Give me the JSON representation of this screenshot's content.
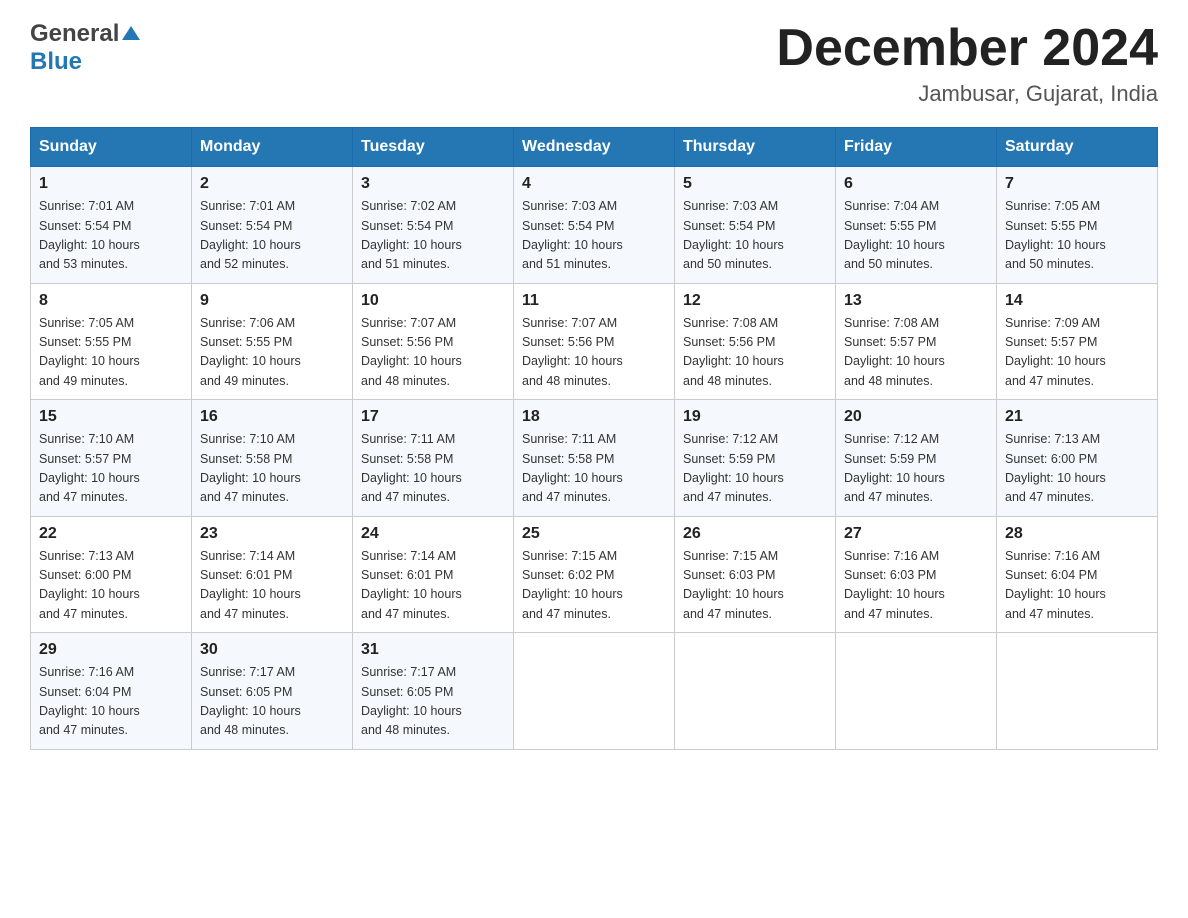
{
  "header": {
    "logo_general": "General",
    "logo_blue": "Blue",
    "month_title": "December 2024",
    "location": "Jambusar, Gujarat, India"
  },
  "days_of_week": [
    "Sunday",
    "Monday",
    "Tuesday",
    "Wednesday",
    "Thursday",
    "Friday",
    "Saturday"
  ],
  "weeks": [
    [
      {
        "day": "1",
        "sunrise": "7:01 AM",
        "sunset": "5:54 PM",
        "daylight": "10 hours and 53 minutes."
      },
      {
        "day": "2",
        "sunrise": "7:01 AM",
        "sunset": "5:54 PM",
        "daylight": "10 hours and 52 minutes."
      },
      {
        "day": "3",
        "sunrise": "7:02 AM",
        "sunset": "5:54 PM",
        "daylight": "10 hours and 51 minutes."
      },
      {
        "day": "4",
        "sunrise": "7:03 AM",
        "sunset": "5:54 PM",
        "daylight": "10 hours and 51 minutes."
      },
      {
        "day": "5",
        "sunrise": "7:03 AM",
        "sunset": "5:54 PM",
        "daylight": "10 hours and 50 minutes."
      },
      {
        "day": "6",
        "sunrise": "7:04 AM",
        "sunset": "5:55 PM",
        "daylight": "10 hours and 50 minutes."
      },
      {
        "day": "7",
        "sunrise": "7:05 AM",
        "sunset": "5:55 PM",
        "daylight": "10 hours and 50 minutes."
      }
    ],
    [
      {
        "day": "8",
        "sunrise": "7:05 AM",
        "sunset": "5:55 PM",
        "daylight": "10 hours and 49 minutes."
      },
      {
        "day": "9",
        "sunrise": "7:06 AM",
        "sunset": "5:55 PM",
        "daylight": "10 hours and 49 minutes."
      },
      {
        "day": "10",
        "sunrise": "7:07 AM",
        "sunset": "5:56 PM",
        "daylight": "10 hours and 48 minutes."
      },
      {
        "day": "11",
        "sunrise": "7:07 AM",
        "sunset": "5:56 PM",
        "daylight": "10 hours and 48 minutes."
      },
      {
        "day": "12",
        "sunrise": "7:08 AM",
        "sunset": "5:56 PM",
        "daylight": "10 hours and 48 minutes."
      },
      {
        "day": "13",
        "sunrise": "7:08 AM",
        "sunset": "5:57 PM",
        "daylight": "10 hours and 48 minutes."
      },
      {
        "day": "14",
        "sunrise": "7:09 AM",
        "sunset": "5:57 PM",
        "daylight": "10 hours and 47 minutes."
      }
    ],
    [
      {
        "day": "15",
        "sunrise": "7:10 AM",
        "sunset": "5:57 PM",
        "daylight": "10 hours and 47 minutes."
      },
      {
        "day": "16",
        "sunrise": "7:10 AM",
        "sunset": "5:58 PM",
        "daylight": "10 hours and 47 minutes."
      },
      {
        "day": "17",
        "sunrise": "7:11 AM",
        "sunset": "5:58 PM",
        "daylight": "10 hours and 47 minutes."
      },
      {
        "day": "18",
        "sunrise": "7:11 AM",
        "sunset": "5:58 PM",
        "daylight": "10 hours and 47 minutes."
      },
      {
        "day": "19",
        "sunrise": "7:12 AM",
        "sunset": "5:59 PM",
        "daylight": "10 hours and 47 minutes."
      },
      {
        "day": "20",
        "sunrise": "7:12 AM",
        "sunset": "5:59 PM",
        "daylight": "10 hours and 47 minutes."
      },
      {
        "day": "21",
        "sunrise": "7:13 AM",
        "sunset": "6:00 PM",
        "daylight": "10 hours and 47 minutes."
      }
    ],
    [
      {
        "day": "22",
        "sunrise": "7:13 AM",
        "sunset": "6:00 PM",
        "daylight": "10 hours and 47 minutes."
      },
      {
        "day": "23",
        "sunrise": "7:14 AM",
        "sunset": "6:01 PM",
        "daylight": "10 hours and 47 minutes."
      },
      {
        "day": "24",
        "sunrise": "7:14 AM",
        "sunset": "6:01 PM",
        "daylight": "10 hours and 47 minutes."
      },
      {
        "day": "25",
        "sunrise": "7:15 AM",
        "sunset": "6:02 PM",
        "daylight": "10 hours and 47 minutes."
      },
      {
        "day": "26",
        "sunrise": "7:15 AM",
        "sunset": "6:03 PM",
        "daylight": "10 hours and 47 minutes."
      },
      {
        "day": "27",
        "sunrise": "7:16 AM",
        "sunset": "6:03 PM",
        "daylight": "10 hours and 47 minutes."
      },
      {
        "day": "28",
        "sunrise": "7:16 AM",
        "sunset": "6:04 PM",
        "daylight": "10 hours and 47 minutes."
      }
    ],
    [
      {
        "day": "29",
        "sunrise": "7:16 AM",
        "sunset": "6:04 PM",
        "daylight": "10 hours and 47 minutes."
      },
      {
        "day": "30",
        "sunrise": "7:17 AM",
        "sunset": "6:05 PM",
        "daylight": "10 hours and 48 minutes."
      },
      {
        "day": "31",
        "sunrise": "7:17 AM",
        "sunset": "6:05 PM",
        "daylight": "10 hours and 48 minutes."
      },
      null,
      null,
      null,
      null
    ]
  ],
  "labels": {
    "sunrise": "Sunrise:",
    "sunset": "Sunset:",
    "daylight": "Daylight:"
  }
}
